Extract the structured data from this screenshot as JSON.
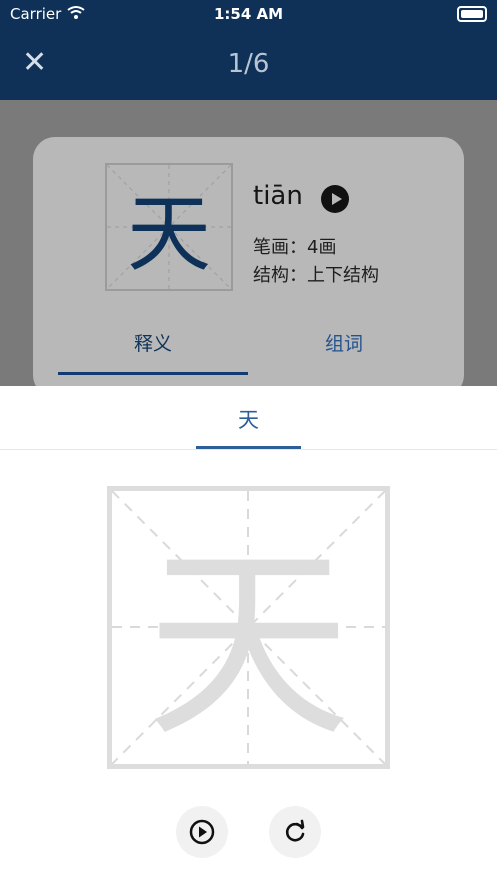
{
  "status_bar": {
    "carrier": "Carrier",
    "time": "1:54 AM"
  },
  "header": {
    "close_label": "✕",
    "progress": "1/6"
  },
  "card": {
    "character": "天",
    "pinyin": "tiān",
    "strokes": "笔画：4画",
    "structure": "结构：上下结构",
    "tabs": [
      "释义",
      "组词"
    ]
  },
  "sheet": {
    "tab_label": "天",
    "character": "天"
  },
  "icons": {
    "wifi": "wifi-icon",
    "battery": "battery-icon",
    "close": "close-icon",
    "audio": "play-circle-icon",
    "play": "play-circle-icon",
    "reset": "refresh-icon"
  },
  "colors": {
    "header": "#0f3157",
    "accent": "#2c5f9a",
    "grid": "#dddddd"
  }
}
